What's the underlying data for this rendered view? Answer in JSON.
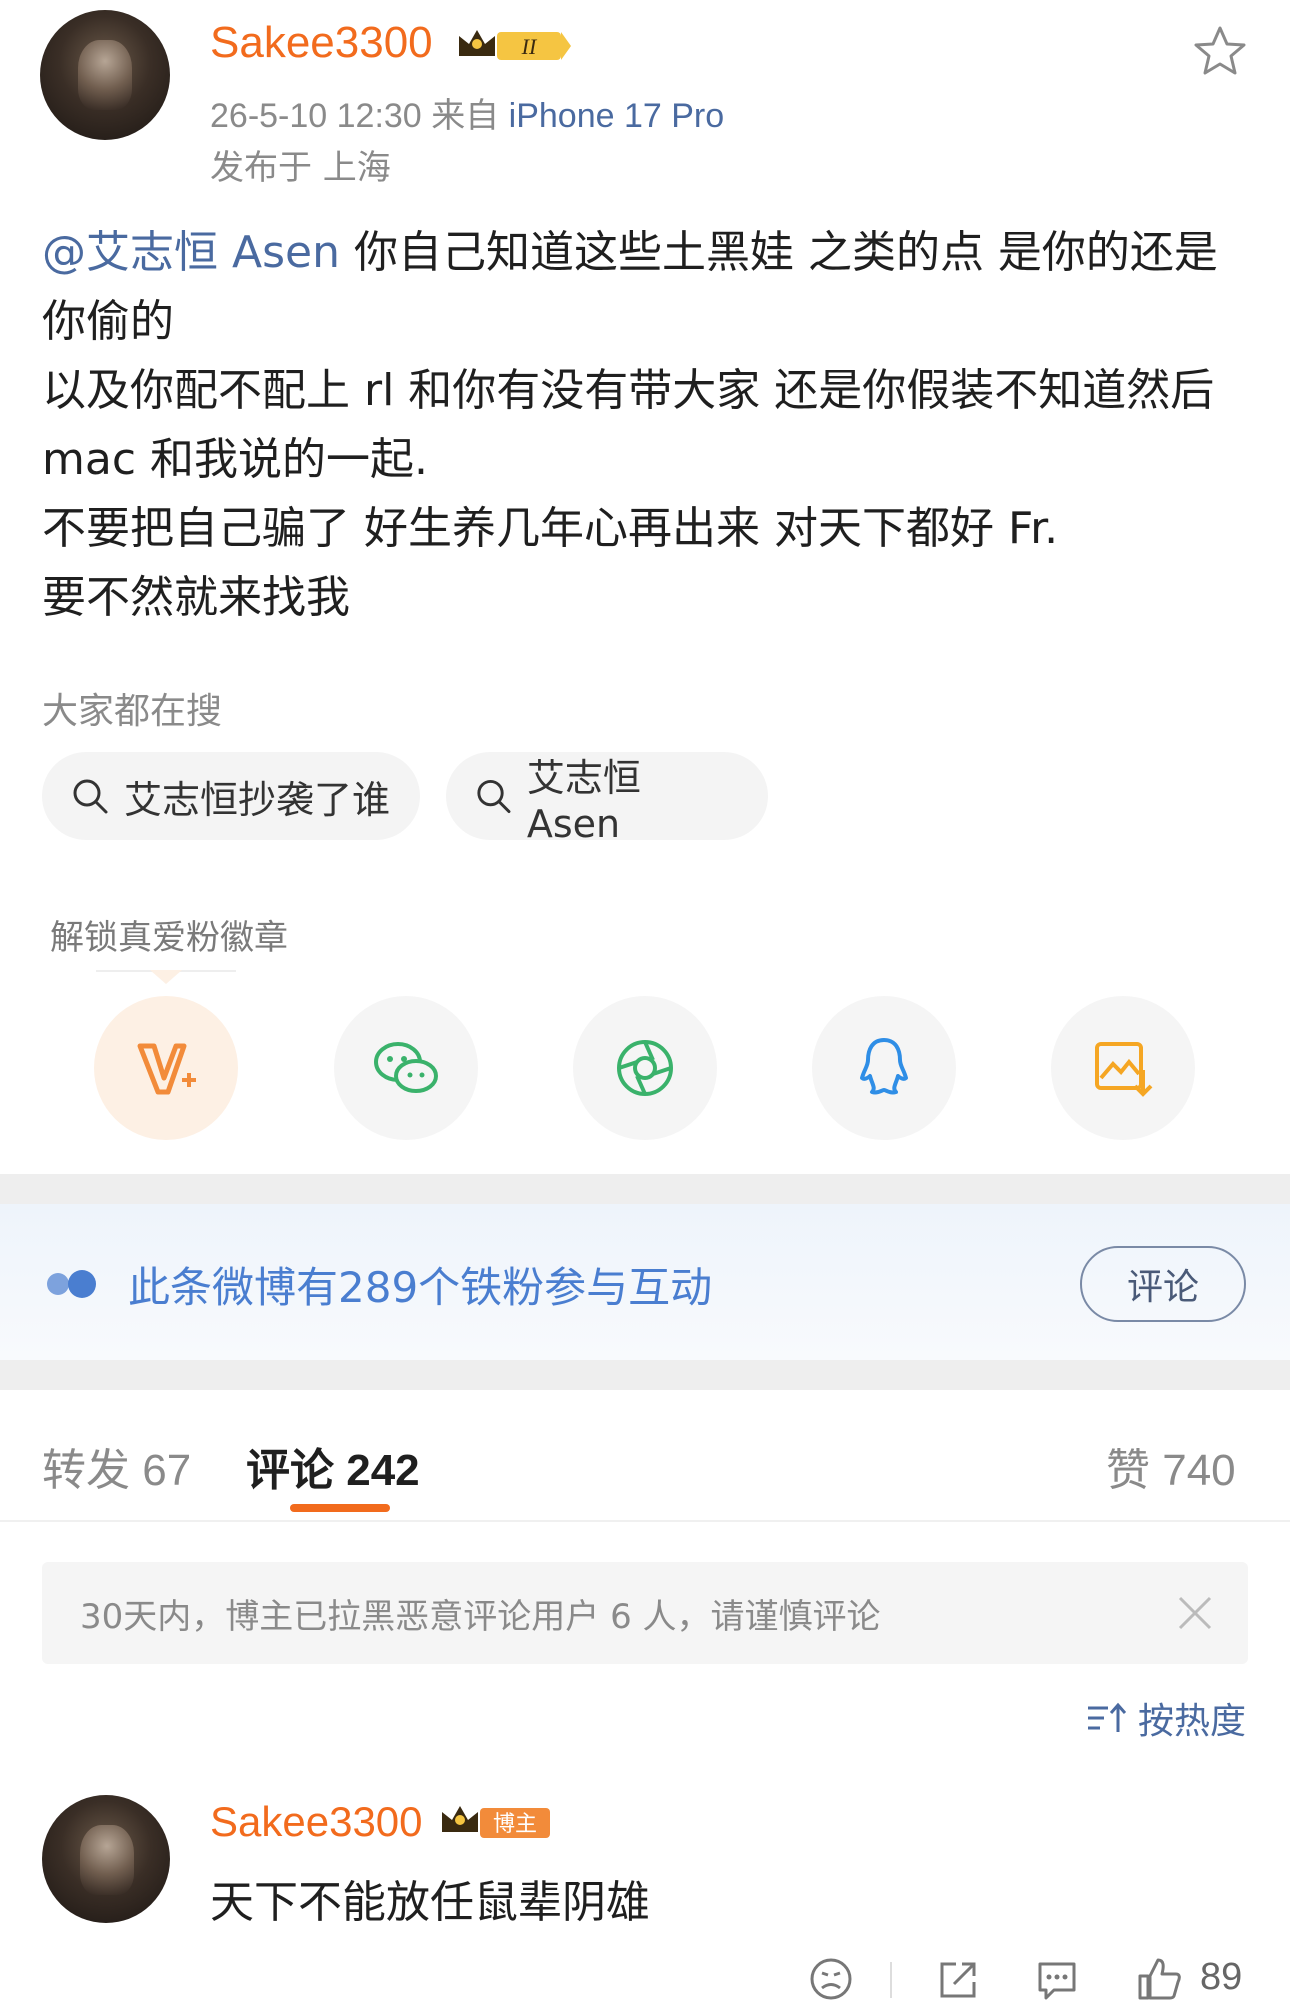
{
  "post": {
    "username": "Sakee3300",
    "level_badge": "II",
    "timestamp": "26-5-10 12:30",
    "source_prefix": "来自",
    "device": "iPhone 17 Pro",
    "location": "发布于 上海",
    "mention": "@艾志恒 Asen",
    "lines": [
      " 你自己知道这些土黑娃 之类的点 是你的还是你偷的",
      "以及你配不配上 rl 和你有没有带大家 还是你假装不知道然后 mac 和我说的一起.",
      "不要把自己骗了 好生养几年心再出来 对天下都好 Fr.",
      "要不然就来找我"
    ]
  },
  "search": {
    "title": "大家都在搜",
    "chips": [
      "艾志恒抄袭了谁",
      "艾志恒 Asen"
    ]
  },
  "share": {
    "unlock_label": "解锁真爱粉徽章",
    "icons": [
      "vplus-icon",
      "wechat-icon",
      "moments-icon",
      "qq-icon",
      "save-image-icon"
    ]
  },
  "fans_banner": {
    "text": "此条微博有289个铁粉参与互动",
    "button": "评论"
  },
  "tabs": {
    "repost": "转发 67",
    "comments": "评论 242",
    "likes": "赞 740"
  },
  "notice": "30天内，博主已拉黑恶意评论用户 6 人，请谨慎评论",
  "sort_label": "按热度",
  "comment": {
    "username": "Sakee3300",
    "badge": "博主",
    "text": "天下不能放任鼠辈阴雄",
    "likes": "89"
  },
  "colors": {
    "accent": "#f26b1d",
    "link": "#4a6aa0",
    "banner_text": "#4a7ed0"
  }
}
